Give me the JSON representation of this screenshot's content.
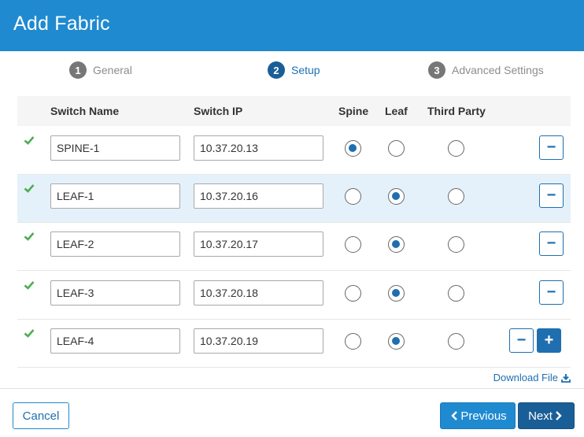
{
  "header": {
    "title": "Add Fabric"
  },
  "steps": [
    {
      "number": "1",
      "label": "General",
      "active": false
    },
    {
      "number": "2",
      "label": "Setup",
      "active": true
    },
    {
      "number": "3",
      "label": "Advanced Settings",
      "active": false
    }
  ],
  "table": {
    "columns": {
      "switch_name": "Switch Name",
      "switch_ip": "Switch IP",
      "spine": "Spine",
      "leaf": "Leaf",
      "third_party": "Third Party"
    },
    "rows": [
      {
        "name": "SPINE-1",
        "ip": "10.37.20.13",
        "role": "spine",
        "valid": true,
        "highlighted": false
      },
      {
        "name": "LEAF-1",
        "ip": "10.37.20.16",
        "role": "leaf",
        "valid": true,
        "highlighted": true
      },
      {
        "name": "LEAF-2",
        "ip": "10.37.20.17",
        "role": "leaf",
        "valid": true,
        "highlighted": false
      },
      {
        "name": "LEAF-3",
        "ip": "10.37.20.18",
        "role": "leaf",
        "valid": true,
        "highlighted": false
      },
      {
        "name": "LEAF-4",
        "ip": "10.37.20.19",
        "role": "leaf",
        "valid": true,
        "highlighted": false
      }
    ]
  },
  "remove_label": "−",
  "add_label": "+",
  "download_label": "Download File",
  "footer": {
    "cancel_label": "Cancel",
    "previous_label": "Previous",
    "next_label": "Next"
  },
  "colors": {
    "header": "#1f8ad0",
    "accent": "#1f6fb0",
    "check": "#4caf50",
    "highlight_row": "#e5f1fa"
  },
  "icons": {
    "valid": "check-icon",
    "download": "download-icon",
    "previous": "chevron-left-icon",
    "next": "chevron-right-icon"
  }
}
